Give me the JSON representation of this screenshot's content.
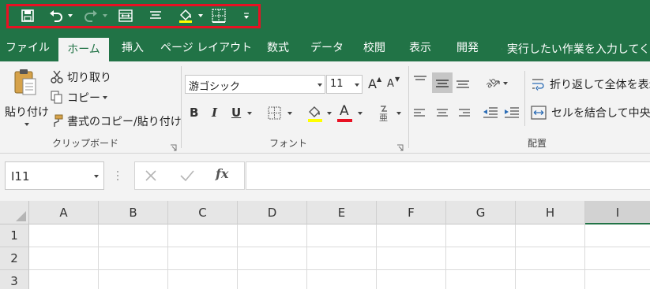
{
  "qat": {
    "icons": [
      "save-icon",
      "undo-icon",
      "redo-icon",
      "merge-cells-icon",
      "align-center-icon",
      "fill-color-icon",
      "borders-icon",
      "customize-qat-icon"
    ]
  },
  "tabs": [
    "ファイル",
    "ホーム",
    "挿入",
    "ページ レイアウト",
    "数式",
    "データ",
    "校閲",
    "表示",
    "開発"
  ],
  "tell_me": "実行したい作業を入力してく",
  "clipboard": {
    "paste": "貼り付け",
    "cut": "切り取り",
    "copy": "コピー",
    "format_painter": "書式のコピー/貼り付け",
    "group_label": "クリップボード"
  },
  "font": {
    "name": "游ゴシック",
    "size": "11",
    "grow": "A",
    "shrink": "A",
    "bold": "B",
    "italic": "I",
    "underline": "U",
    "font_color_letter": "A",
    "group_label": "フォント"
  },
  "alignment": {
    "wrap_text": "折り返して全体を表示",
    "merge_center": "セルを結合して中央揃",
    "group_label": "配置"
  },
  "formula_bar": {
    "name_box": "I11",
    "fx": "fx",
    "value": ""
  },
  "grid": {
    "columns": [
      "A",
      "B",
      "C",
      "D",
      "E",
      "F",
      "G",
      "H",
      "I"
    ],
    "rows": [
      "1",
      "2",
      "3"
    ]
  },
  "colors": {
    "excel_green": "#217346",
    "highlight_frame": "#e81123",
    "font_color_bar": "#e81123",
    "fill_color_bar": "#ffff00"
  }
}
